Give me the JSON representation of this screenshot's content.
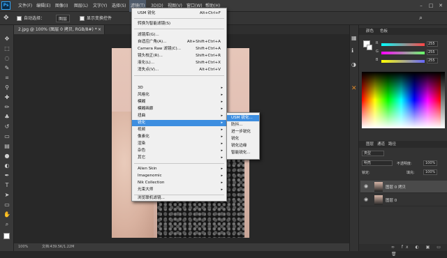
{
  "app": {
    "logo": "Ps"
  },
  "menubar": {
    "items": [
      "文件(F)",
      "编辑(E)",
      "图像(I)",
      "图层(L)",
      "文字(Y)",
      "选择(S)",
      "滤镜(T)",
      "3D(D)",
      "视图(V)",
      "窗口(W)",
      "帮助(H)"
    ]
  },
  "window_controls": {
    "minimize": "–",
    "maximize": "□",
    "close": "✕"
  },
  "options": {
    "auto_select_label": "自动选择：",
    "auto_select_value": "图层",
    "transform_label": "显示变换控件"
  },
  "document": {
    "tab_label": "2.jpg @ 100% (图层 0 拷贝, RGB/8#) *",
    "tab_close": "×",
    "zoom": "100%",
    "doc_info": "文档:439.5K/1.22M"
  },
  "filter_menu": {
    "items": [
      {
        "label": "USM 锐化",
        "shortcut": "Alt+Ctrl+F"
      },
      {
        "label": "转换为智能滤镜(S)",
        "shortcut": ""
      },
      {
        "label": "滤镜库(G)...",
        "shortcut": ""
      },
      {
        "label": "自适应广角(A)...",
        "shortcut": "Alt+Shift+Ctrl+A"
      },
      {
        "label": "Camera Raw 滤镜(C)...",
        "shortcut": "Shift+Ctrl+A"
      },
      {
        "label": "镜头校正(R)...",
        "shortcut": "Shift+Ctrl+R"
      },
      {
        "label": "液化(L)...",
        "shortcut": "Shift+Ctrl+X"
      },
      {
        "label": "消失点(V)...",
        "shortcut": "Alt+Ctrl+V"
      },
      {
        "label": "3D",
        "shortcut": ""
      },
      {
        "label": "风格化",
        "shortcut": ""
      },
      {
        "label": "模糊",
        "shortcut": ""
      },
      {
        "label": "模糊画廊",
        "shortcut": ""
      },
      {
        "label": "扭曲",
        "shortcut": ""
      },
      {
        "label": "锐化",
        "shortcut": ""
      },
      {
        "label": "视频",
        "shortcut": ""
      },
      {
        "label": "像素化",
        "shortcut": ""
      },
      {
        "label": "渲染",
        "shortcut": ""
      },
      {
        "label": "杂色",
        "shortcut": ""
      },
      {
        "label": "其它",
        "shortcut": ""
      },
      {
        "label": "Alien Skin",
        "shortcut": ""
      },
      {
        "label": "Imagenomic",
        "shortcut": ""
      },
      {
        "label": "Nik Collection",
        "shortcut": ""
      },
      {
        "label": "光束大师",
        "shortcut": ""
      },
      {
        "label": "浏览联机滤镜...",
        "shortcut": ""
      }
    ],
    "arrow": "▸"
  },
  "sharpen_submenu": {
    "items": [
      "USM 锐化...",
      "防抖...",
      "进一步锐化",
      "锐化",
      "锐化边缘",
      "智能锐化..."
    ]
  },
  "panels": {
    "color_tabs": [
      "颜色",
      "色板"
    ],
    "sliders": [
      {
        "label": "R",
        "value": "255",
        "color": "#ff4848"
      },
      {
        "label": "G",
        "value": "255",
        "color": "#3cff3c"
      },
      {
        "label": "B",
        "value": "255",
        "color": "#4a4aff"
      }
    ],
    "layers_tabs": [
      "图层",
      "通道",
      "路径"
    ],
    "kind_label": "类型",
    "blend_mode": "明亮",
    "opacity_label": "不透明度:",
    "opacity_value": "100%",
    "lock_label": "锁定:",
    "fill_label": "填充:",
    "fill_value": "100%",
    "layers": [
      "图层 0 拷贝",
      "图层 0"
    ]
  },
  "colors": {
    "accent": "#3d8ee0",
    "brand": "#31a8ff"
  }
}
